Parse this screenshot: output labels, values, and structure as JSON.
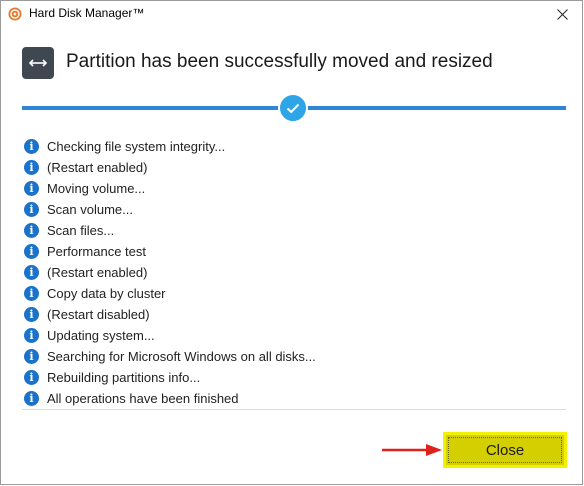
{
  "window": {
    "title": "Hard Disk Manager™"
  },
  "header": {
    "icon": "move-resize-icon",
    "title": "Partition has been successfully moved and resized",
    "status_icon": "checkmark-icon"
  },
  "log": {
    "items": [
      "Checking file system integrity...",
      "(Restart enabled)",
      "Moving volume...",
      "Scan volume...",
      "Scan files...",
      "Performance test",
      "(Restart enabled)",
      "Copy data by cluster",
      "(Restart disabled)",
      "Updating system...",
      "Searching for Microsoft Windows on all disks...",
      "Rebuilding partitions info...",
      "All operations have been finished"
    ]
  },
  "footer": {
    "close_label": "Close"
  },
  "colors": {
    "accent": "#2e86d4",
    "info": "#1a73c9",
    "close_button": "#d3cf00",
    "highlight_border": "#f2f200",
    "arrow": "#e0201b"
  }
}
